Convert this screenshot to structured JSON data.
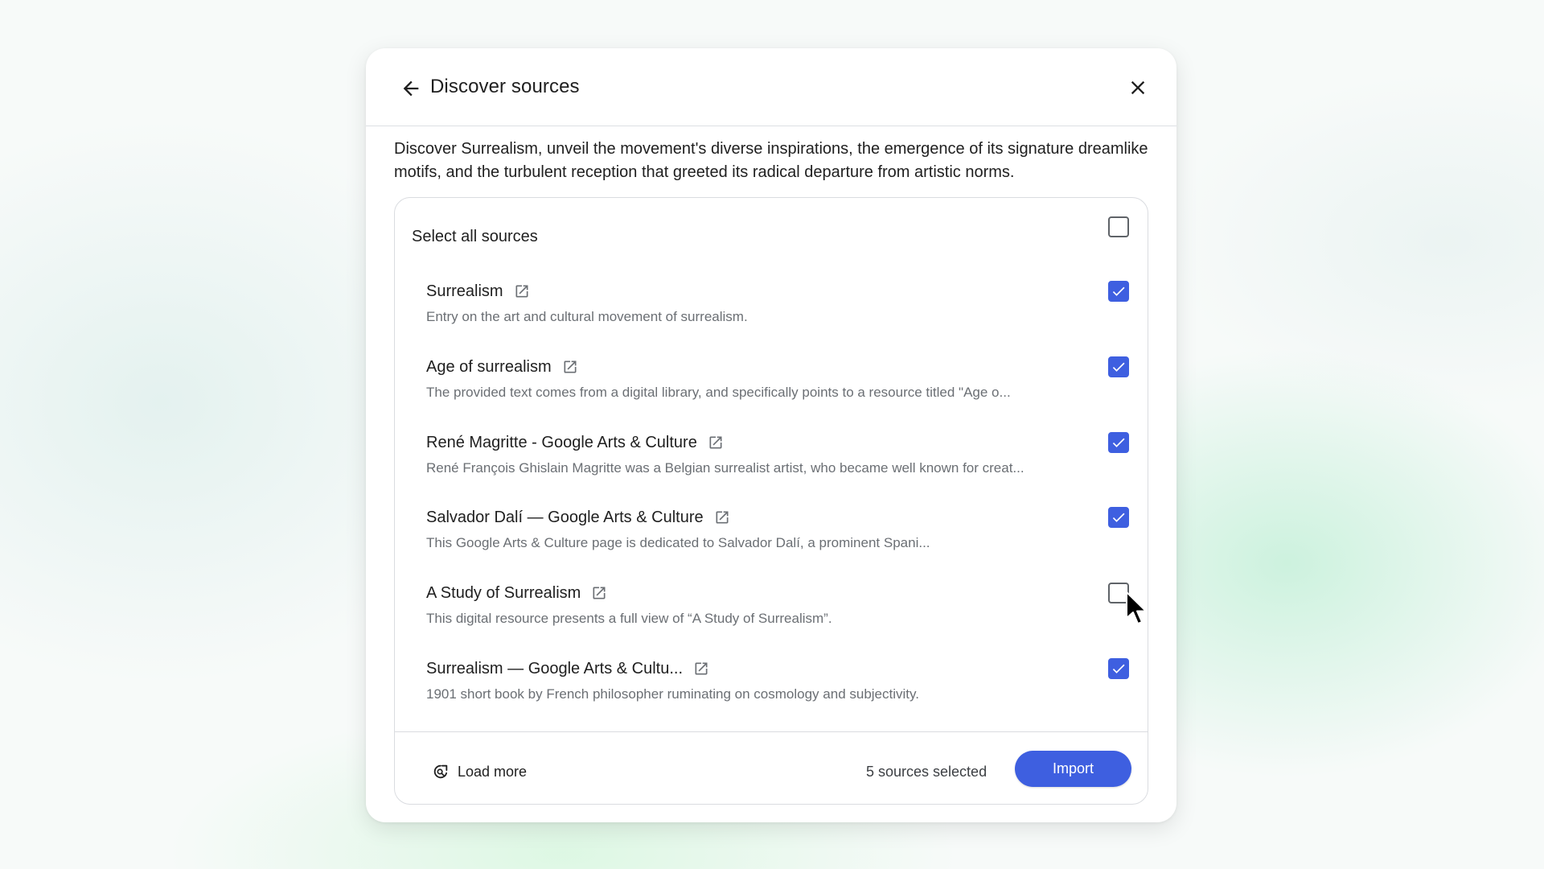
{
  "dialog": {
    "title": "Discover sources",
    "description": "Discover Surrealism, unveil the movement's diverse inspirations, the emergence of its signature dreamlike motifs, and the turbulent reception that greeted its radical departure from artistic norms.",
    "select_all_label": "Select all sources",
    "select_all_checked": false,
    "sources": [
      {
        "title": "Surrealism",
        "description": "Entry on the art and cultural movement of surrealism.",
        "checked": true
      },
      {
        "title": "Age of surrealism",
        "description": "The provided text comes from a digital library, and specifically points to a resource titled \"Age o...",
        "checked": true
      },
      {
        "title": "René Magritte - Google Arts & Culture",
        "description": "René François Ghislain Magritte was a Belgian surrealist artist, who became well known for creat...",
        "checked": true
      },
      {
        "title": "Salvador Dalí — Google Arts & Culture",
        "description": "This Google Arts & Culture page is dedicated to Salvador Dalí, a prominent Spani...",
        "checked": true
      },
      {
        "title": "A Study of Surrealism",
        "description": "This digital resource presents a full view of “A Study of Surrealism”.",
        "checked": false
      },
      {
        "title": "Surrealism — Google Arts & Cultu...",
        "description": "1901 short book by French philosopher ruminating on cosmology and subjectivity.",
        "checked": true
      }
    ],
    "footer": {
      "load_more_label": "Load more",
      "selected_count_text": "5 sources selected",
      "import_label": "Import"
    }
  },
  "colors": {
    "accent": "#3e5fe0",
    "text_primary": "#1f1f1f",
    "text_secondary": "#6b6f74",
    "border": "#dadce0"
  },
  "icons": {
    "back": "arrow-back-icon",
    "close": "close-icon",
    "open_external": "open-in-new-icon",
    "load_more": "load-more-icon",
    "check": "checkmark-icon",
    "cursor": "mouse-pointer-icon"
  }
}
